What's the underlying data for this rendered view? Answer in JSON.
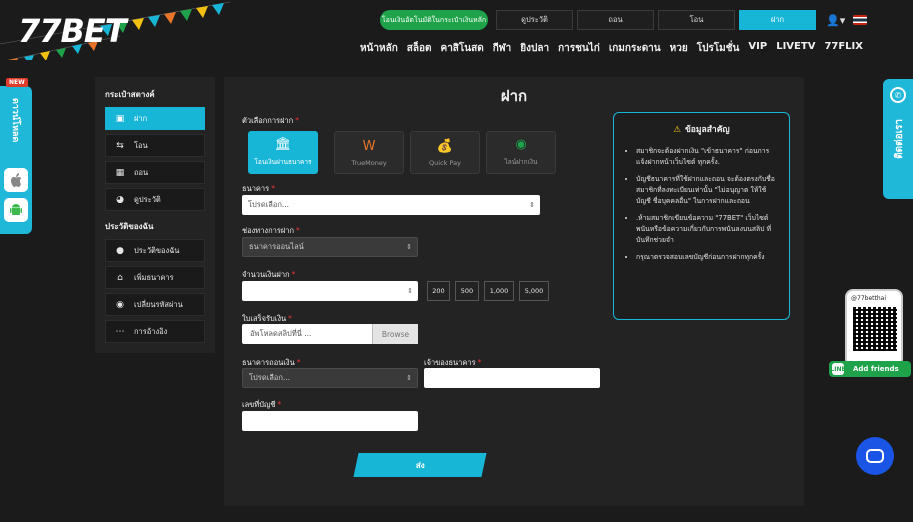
{
  "brand": {
    "logo": "77BET",
    "accent": "#18b6d6",
    "promo_green": "#1ea34a"
  },
  "header": {
    "promo_button": "โอนเงินอัตโนมัติในกระเป๋าเงินหลัก",
    "buttons": [
      "ดูประวัติ",
      "ถอน",
      "โอน",
      "ฝาก"
    ],
    "active_button": "ฝาก",
    "nav": [
      "หน้าหลัก",
      "สล็อต",
      "คาสิโนสด",
      "กีฬา",
      "ยิงปลา",
      "การชนไก่",
      "เกมกระดาน",
      "หวย",
      "โปรโมชั่น",
      "VIP",
      "LIVETV",
      "77FLIX"
    ]
  },
  "apptab": {
    "new_badge": "NEW",
    "label": "ดาวน์โหลด",
    "icons": [
      "apple-icon",
      "android-icon"
    ]
  },
  "contact_tab": {
    "label": "ติดต่อเรา",
    "icon": "whatsapp-icon"
  },
  "line": {
    "handle": "@77betthai",
    "add_friends": "Add friends",
    "icon": "line-icon"
  },
  "sidebar": {
    "wallet_heading": "กระเป๋าสตางค์",
    "wallet_items": [
      {
        "label": "ฝาก",
        "icon": "wallet-icon",
        "active": true
      },
      {
        "label": "โอน",
        "icon": "transfer-icon",
        "active": false
      },
      {
        "label": "ถอน",
        "icon": "withdraw-icon",
        "active": false
      },
      {
        "label": "ดูประวัติ",
        "icon": "history-icon",
        "active": false
      }
    ],
    "profile_heading": "ประวัติของฉัน",
    "profile_items": [
      {
        "label": "ประวัติของฉัน",
        "icon": "user-icon"
      },
      {
        "label": "เพิ่มธนาคาร",
        "icon": "bank-add-icon"
      },
      {
        "label": "เปลี่ยนรหัสผ่าน",
        "icon": "key-icon"
      },
      {
        "label": "การอ้างอิง",
        "icon": "referral-icon"
      }
    ]
  },
  "form": {
    "title": "ฝาก",
    "method_label": "ตัวเลือกการฝาก",
    "methods": [
      {
        "label": "โอนเงินผ่านธนาคาร",
        "icon": "bank-icon",
        "active": true
      },
      {
        "label": "TrueMoney",
        "icon": "truemoney-icon",
        "active": false
      },
      {
        "label": "Quick Pay",
        "icon": "moneybag-icon",
        "active": false
      },
      {
        "label": "ไลน์ฝากเงิน",
        "icon": "line-icon",
        "active": false
      }
    ],
    "bank_label": "ธนาคาร",
    "bank_value": "โปรดเลือก...",
    "channel_label": "ช่องทางการฝาก",
    "channel_value": "ธนาคารออนไลน์",
    "amount_label": "จำนวนเงินฝาก",
    "amount_value": "",
    "quick_amounts": [
      "200",
      "500",
      "1,000",
      "5,000"
    ],
    "slip_label": "ใบเสร็จรับเงิน",
    "slip_placeholder": "อัพโหลดสลิปที่นี่ ...",
    "browse": "Browse",
    "depositor_bank_label": "ธนาคารถอนเงิน",
    "depositor_bank_value": "โปรดเลือก...",
    "owner_label": "เจ้าของธนาคาร",
    "owner_value": "",
    "account_label": "เลขที่บัญชี",
    "account_value": "",
    "submit": "ส่ง"
  },
  "info": {
    "heading": "ข้อมูลสำคัญ",
    "items": [
      "สมาชิกจะต้องฝากเงิน \"เข้าธนาคาร\" ก่อนการแจ้งฝากหน้าเว็บไซต์ ทุกครั้ง.",
      "บัญชีธนาคารที่ใช้ฝากและถอน จะต้องตรงกับชื่อสมาชิกที่ลงทะเบียนเท่านั้น \"ไม่อนุญาต ให้ใช้บัญชี ชื่อบุคคลอื่น\" ในการฝากและถอน",
      ".ห้ามสมาชิกเขียนข้อความ \"77BET\" เว็บไซต์พนันหรือข้อความเกี่ยวกับการพนันลงบนสลิป ที่บันทึกช่วยจำ",
      "กรุณาตรวจสอบเลขบัญชีก่อนการฝากทุกครั้ง"
    ]
  }
}
